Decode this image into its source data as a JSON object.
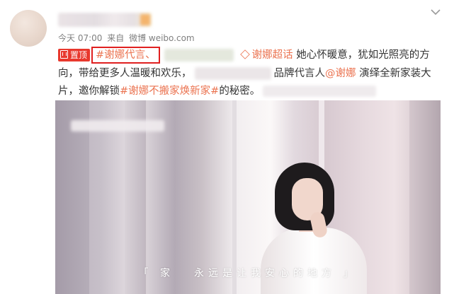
{
  "post": {
    "timestamp": "今天 07:00",
    "source_prefix": "来自",
    "source": "微博 weibo.com",
    "pin_label": "置顶",
    "hashtag_highlight": "#谢娜代言、",
    "supertopic": "谢娜超话",
    "text_1": "她心怀暖意，犹如光照亮的方",
    "text_2": "向，带给更多人温暖和欢乐，",
    "text_3": "品牌代言人",
    "mention": "@谢娜",
    "text_4": "演绎全新家装大",
    "text_5": "片，邀你解锁",
    "hashtag_2": "#谢娜不搬家焕新家#",
    "text_6": "的秘密。"
  },
  "media": {
    "caption_left": "「 家",
    "caption_right": "永远是让我安心的地方 」"
  },
  "icons": {
    "more": "chevron-down-icon",
    "supertopic": "diamond-icon",
    "pin": "pin-icon"
  },
  "colors": {
    "accent": "#eb7350",
    "pin_bg": "#e8382d",
    "highlight_box": "#e02020"
  }
}
